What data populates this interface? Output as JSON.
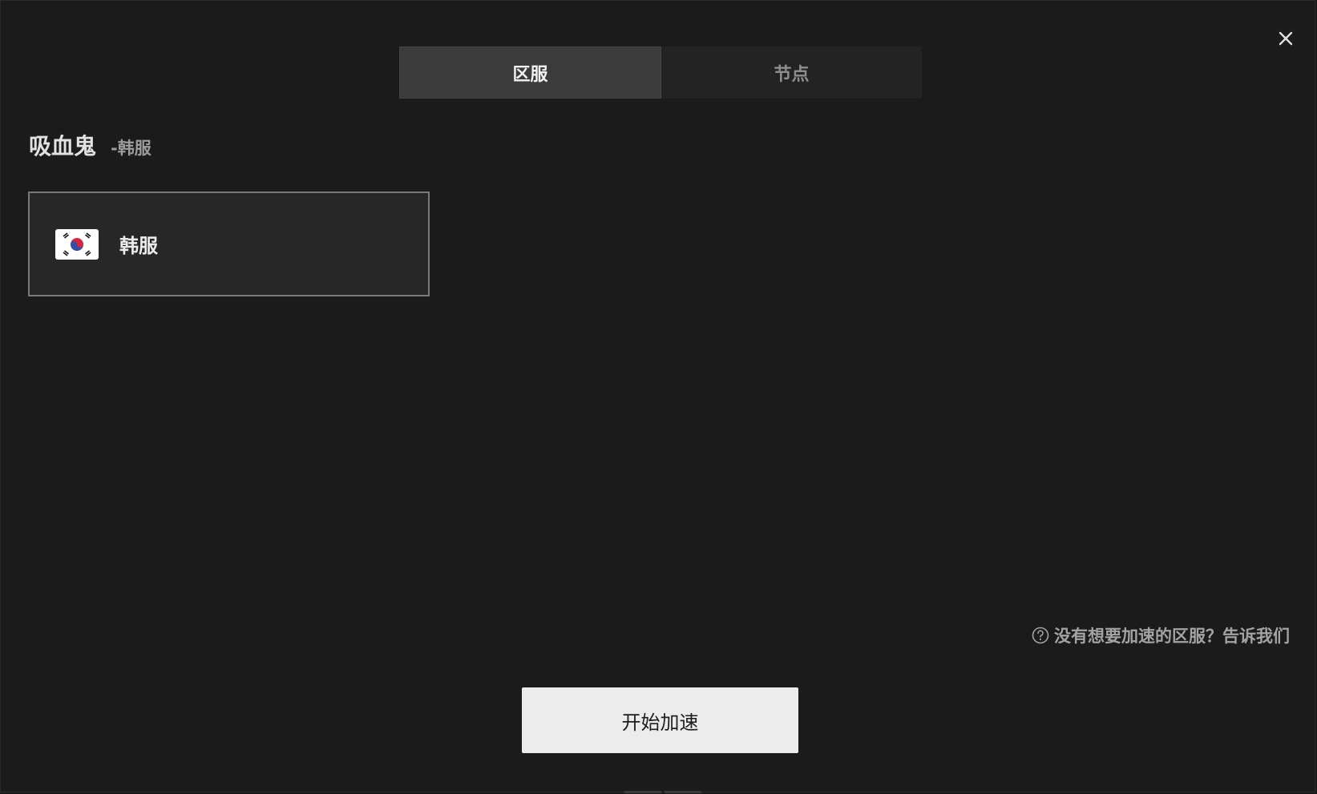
{
  "tabs": [
    {
      "label": "区服",
      "active": true
    },
    {
      "label": "节点",
      "active": false
    }
  ],
  "game": {
    "name": "吸血鬼",
    "region_suffix": "-韩服"
  },
  "servers": [
    {
      "label": "韩服",
      "icon": "south-korea-flag-icon"
    }
  ],
  "feedback": {
    "icon": "question-circle-icon",
    "text": "没有想要加速的区服？告诉我们"
  },
  "start_button": {
    "label": "开始加速"
  },
  "colors": {
    "background": "#1b1b1b",
    "tab_active": "#3b3b3b",
    "card_border": "#7a7a7a",
    "button_bg": "#ececec"
  }
}
